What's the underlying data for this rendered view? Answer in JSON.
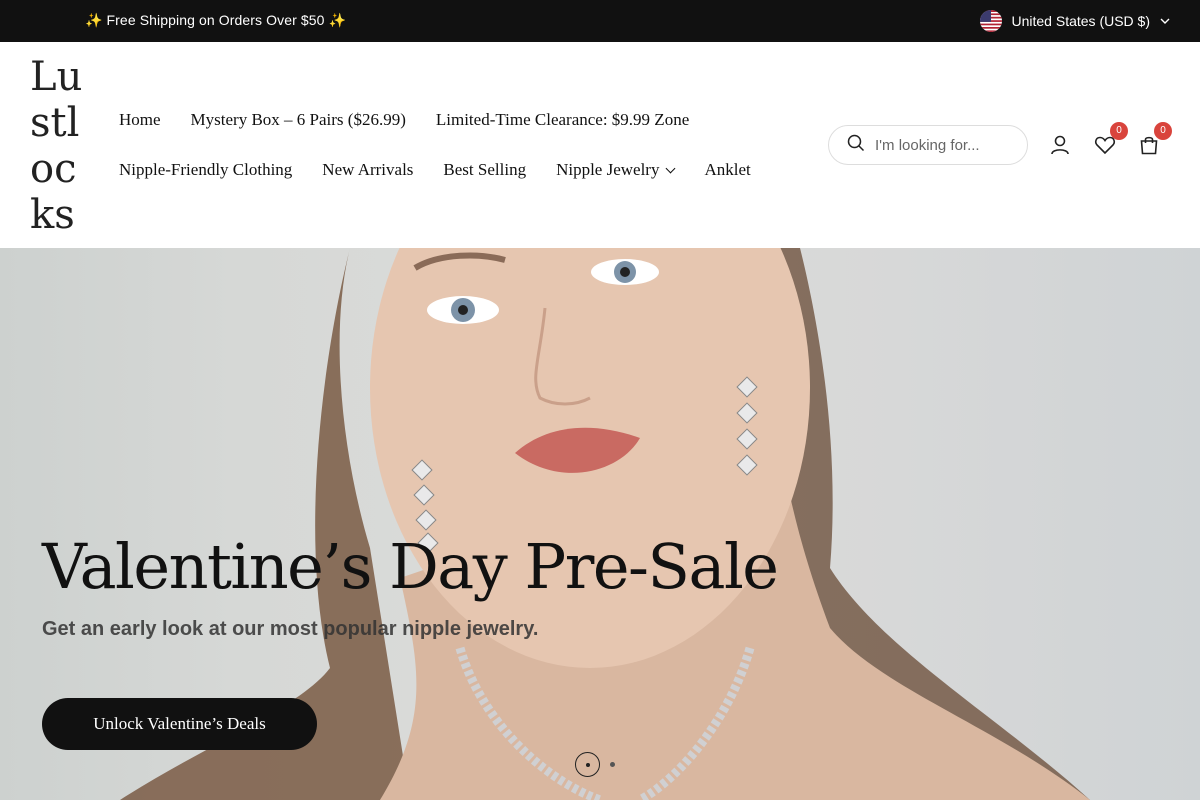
{
  "announcement": "✨ Free Shipping on Orders Over $50 ✨",
  "currency": {
    "label": "United States (USD $)",
    "flag_icon": "us-flag-icon"
  },
  "logo": "Lustlocks",
  "nav": {
    "row1": [
      "Home",
      "Mystery Box – 6 Pairs ($26.99)",
      "Limited-Time Clearance: $9.99 Zone"
    ],
    "row2": [
      "Nipple-Friendly Clothing",
      "New Arrivals",
      "Best Selling",
      "Nipple Jewelry",
      "Anklet"
    ]
  },
  "search": {
    "placeholder": "I'm looking for..."
  },
  "header_icons": {
    "account_icon": "user-icon",
    "wishlist_count": "0",
    "cart_count": "0"
  },
  "hero": {
    "title": "Valentine’s Day Pre-Sale",
    "subtitle": "Get an early look at our most popular nipple jewelry.",
    "cta_label": "Unlock Valentine’s Deals",
    "slide_count": 2,
    "active_slide": 1
  },
  "colors": {
    "topbar_bg": "#111111",
    "badge": "#d9443c",
    "cta_bg": "#111111"
  }
}
